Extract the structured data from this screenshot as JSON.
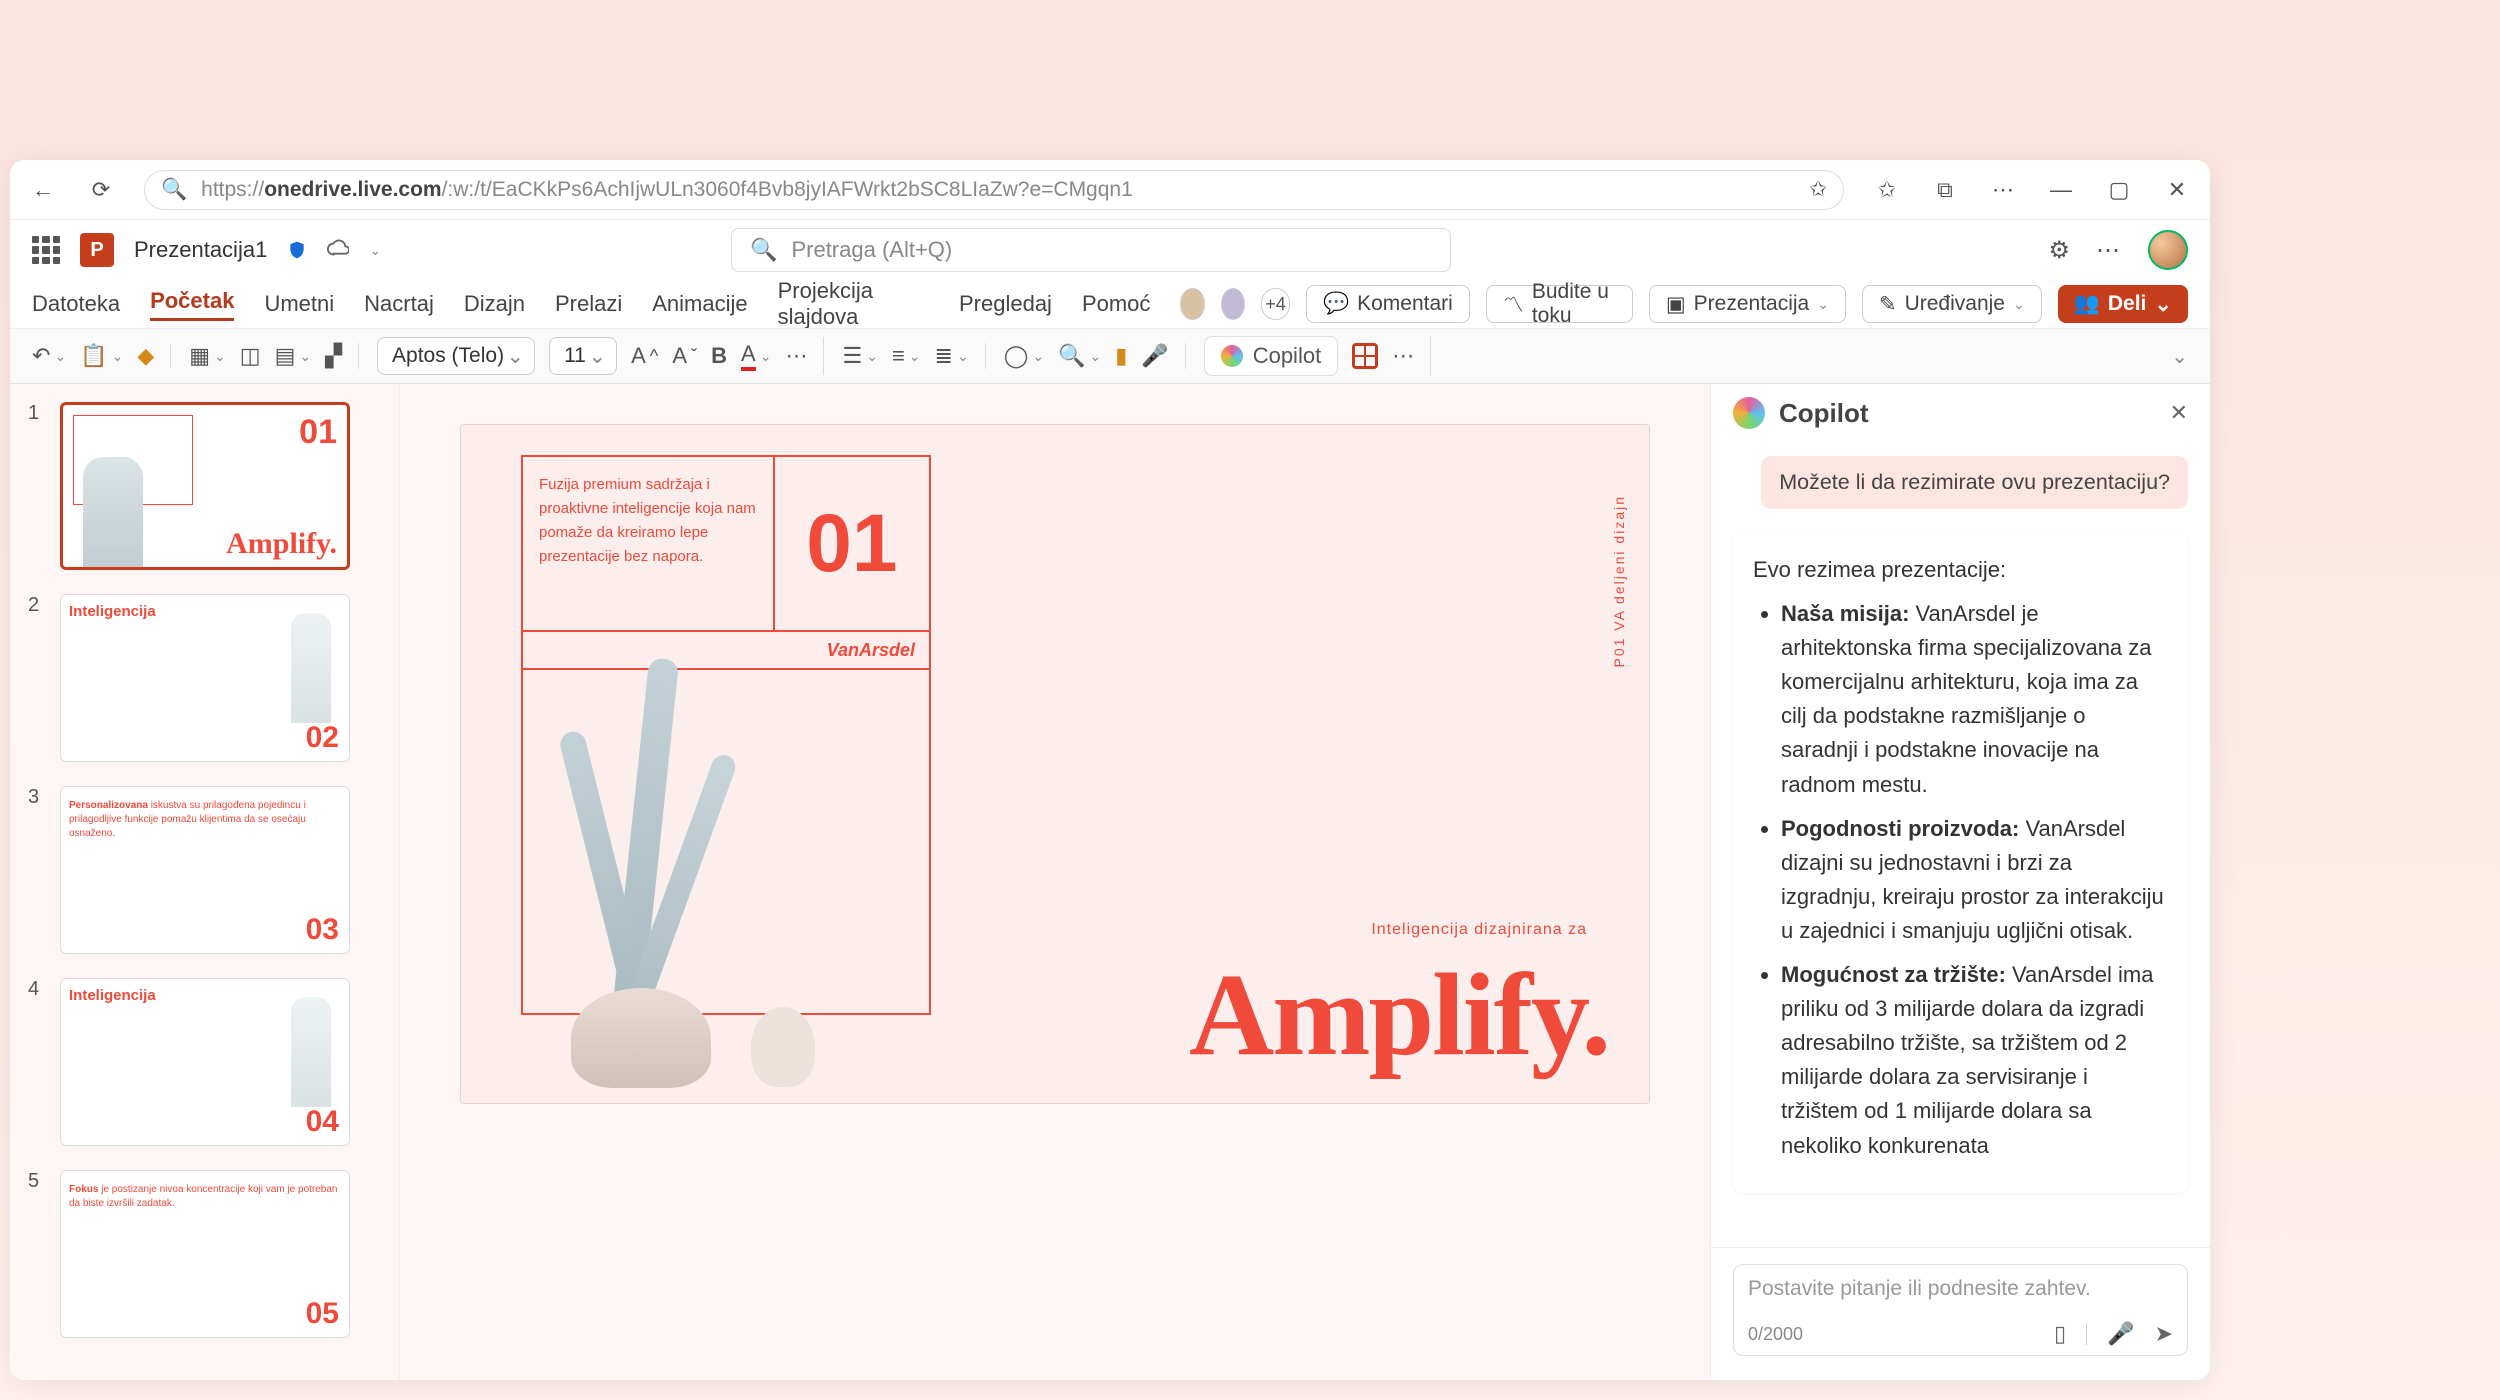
{
  "browser": {
    "url_host": "onedrive.live.com",
    "url_prefix": "https://",
    "url_path": "/:w:/t/EaCKkPs6AchIjwULn3060f4Bvb8jyIAFWrkt2bSC8LIaZw?e=CMgqn1"
  },
  "app": {
    "doc_title": "Prezentacija1",
    "search_placeholder": "Pretraga (Alt+Q)"
  },
  "ribbon_tabs": [
    "Datoteka",
    "Početak",
    "Umetni",
    "Nacrtaj",
    "Dizajn",
    "Prelazi",
    "Animacije",
    "Projekcija slajdova",
    "Pregledaj",
    "Pomoć"
  ],
  "ribbon_active": "Početak",
  "ribbon_right": {
    "extra_count": "+4",
    "comments": "Komentari",
    "catchup": "Budite u toku",
    "present": "Prezentacija",
    "editing": "Uređivanje",
    "share": "Deli"
  },
  "toolbar": {
    "font_name": "Aptos (Telo)",
    "font_size": "11",
    "copilot_label": "Copilot"
  },
  "thumbnails": [
    {
      "n": "1",
      "big_num": "01",
      "word": "Amplify."
    },
    {
      "n": "2",
      "title": "Inteligencija",
      "big_num": "02"
    },
    {
      "n": "3",
      "title": "Personalizovana",
      "body": "iskustva su prilagođena pojedincu i prilagodljive funkcije pomažu klijentima da se osećaju osnaženo.",
      "big_num": "03"
    },
    {
      "n": "4",
      "title": "Inteligencija",
      "big_num": "04"
    },
    {
      "n": "5",
      "title": "Fokus",
      "body": "je postizanje nivoa koncentracije koji vam je potreban da biste izvršili zadatak.",
      "big_num": "05"
    }
  ],
  "canvas": {
    "blurb": "Fuzija premium sadržaja i proaktivne inteligencije koja nam pomaže da kreiramo lepe prezentacije bez napora.",
    "big_num": "01",
    "brand": "VanArsdel",
    "tagline": "Inteligencija dizajnirana za",
    "big_word": "Amplify.",
    "side_vertical": "P01  VA deljeni dizajn"
  },
  "copilot": {
    "panel_title": "Copilot",
    "user_msg": "Možete li da rezimirate ovu prezentaciju?",
    "intro": "Evo rezimea prezentacije:",
    "bullets": [
      {
        "bold": "Naša misija:",
        "text": " VanArsdel je arhitektonska firma specijalizovana za komercijalnu arhitekturu, koja ima za cilj da podstakne razmišljanje o saradnji i podstakne inovacije na radnom mestu."
      },
      {
        "bold": "Pogodnosti proizvoda:",
        "text": " VanArsdel dizajni su jednostavni i brzi za izgradnju, kreiraju prostor za interakciju u zajednici i smanjuju ugljični otisak."
      },
      {
        "bold": "Mogućnost za tržište:",
        "text": " VanArsdel ima priliku od 3 milijarde dolara da izgradi adresabilno tržište, sa tržištem od 2 milijarde dolara za servisiranje i tržištem od 1 milijarde dolara sa nekoliko konkurenata"
      }
    ],
    "input_placeholder": "Postavite pitanje ili podnesite zahtev.",
    "char_count": "0/2000"
  }
}
